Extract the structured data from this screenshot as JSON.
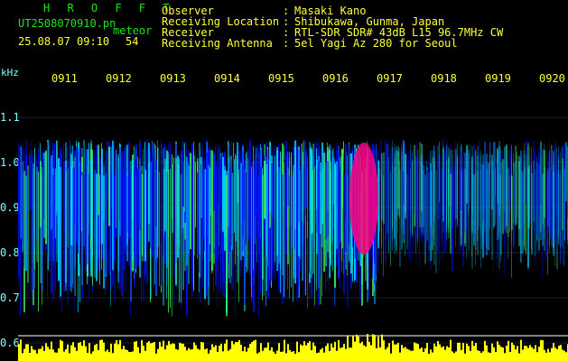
{
  "header": {
    "title": "H R O F F T",
    "filename": "UT2508070910.pn",
    "meteor_label": "meteor",
    "date_time": "25.08.07 09:10",
    "meteor_count": "54",
    "info": [
      {
        "label": "Observer",
        "value": "Masaki Kano"
      },
      {
        "label": "Receiving Location",
        "value": "Shibukawa, Gunma, Japan"
      },
      {
        "label": "Receiver",
        "value": "RTL-SDR SDR# 43dB L15 96.7MHz CW"
      },
      {
        "label": "Receiving Antenna",
        "value": "5el Yagi Az 280 for Seoul"
      }
    ],
    "separator": ":"
  },
  "spectrogram": {
    "freq_unit": "kHz",
    "freq_ticks": [
      "1.1",
      "1.0",
      "0.9",
      "0.8",
      "0.7",
      "0.6"
    ],
    "time_ticks": [
      "0911",
      "0912",
      "0913",
      "0914",
      "0915",
      "0916",
      "0917",
      "0918",
      "0919",
      "0920"
    ],
    "colors": {
      "text_green": "#19e619",
      "text_yellow": "#ffff3c",
      "text_cyan": "#7fffff",
      "signal_low": "#0010ff",
      "signal_mid": "#00e0ff",
      "signal_high": "#ff0080",
      "baseline": "#ffff00"
    }
  }
}
